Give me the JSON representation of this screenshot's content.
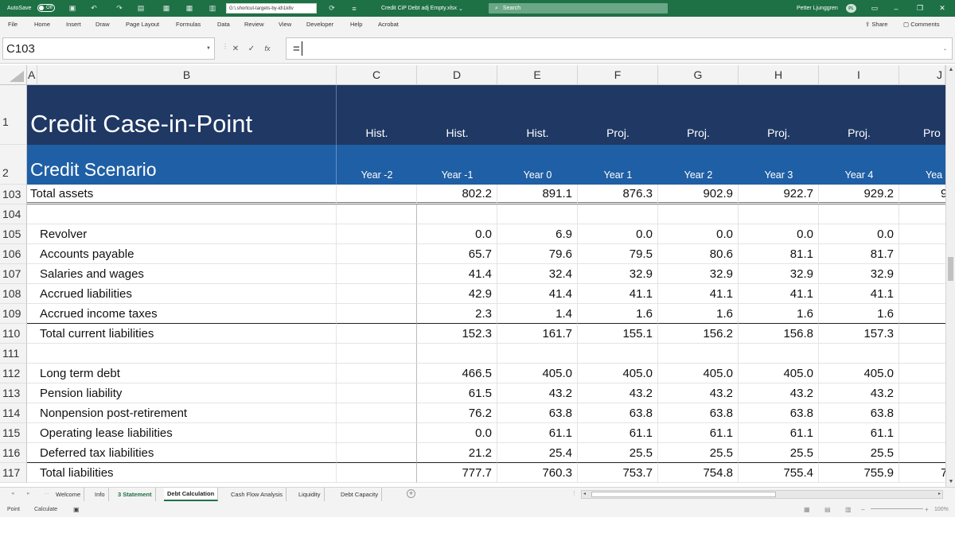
{
  "titlebar": {
    "autosave_label": "AutoSave",
    "autosave_state": "Off",
    "path": "G:\\.shortcut-targets-by-id\\1k8v",
    "filename": "Credit CiP Debt adj Empty.xlsx",
    "search_placeholder": "Search",
    "user": "Petter Ljunggren",
    "user_initials": "PL"
  },
  "ribbon": {
    "tabs": [
      "File",
      "Home",
      "Insert",
      "Draw",
      "Page Layout",
      "Formulas",
      "Data",
      "Review",
      "View",
      "Developer",
      "Help",
      "Acrobat"
    ],
    "share": "Share",
    "comments": "Comments"
  },
  "formula_bar": {
    "name_box": "C103",
    "formula": "="
  },
  "columns": [
    "A",
    "B",
    "C",
    "D",
    "E",
    "F",
    "G",
    "H",
    "I",
    "J"
  ],
  "header": {
    "row1_num": "1",
    "row2_num": "2",
    "title": "Credit Case-in-Point",
    "subtitle": "Credit Scenario",
    "periods": [
      "Hist.",
      "Hist.",
      "Hist.",
      "Proj.",
      "Proj.",
      "Proj.",
      "Proj.",
      "Pro"
    ],
    "years": [
      "Year -2",
      "Year -1",
      "Year 0",
      "Year 1",
      "Year 2",
      "Year 3",
      "Year 4",
      "Yea"
    ]
  },
  "rows": [
    {
      "num": "103",
      "label": "Total assets",
      "values": [
        "",
        "802.2",
        "891.1",
        "876.3",
        "902.9",
        "922.7",
        "929.2",
        "9"
      ],
      "indent": false
    },
    {
      "num": "104",
      "label": "",
      "values": [
        "",
        "",
        "",
        "",
        "",
        "",
        "",
        ""
      ],
      "indent": false
    },
    {
      "num": "105",
      "label": "Revolver",
      "values": [
        "",
        "0.0",
        "6.9",
        "0.0",
        "0.0",
        "0.0",
        "0.0",
        ""
      ],
      "indent": true
    },
    {
      "num": "106",
      "label": "Accounts payable",
      "values": [
        "",
        "65.7",
        "79.6",
        "79.5",
        "80.6",
        "81.1",
        "81.7",
        ""
      ],
      "indent": true
    },
    {
      "num": "107",
      "label": "Salaries and wages",
      "values": [
        "",
        "41.4",
        "32.4",
        "32.9",
        "32.9",
        "32.9",
        "32.9",
        ""
      ],
      "indent": true
    },
    {
      "num": "108",
      "label": "Accrued liabilities",
      "values": [
        "",
        "42.9",
        "41.4",
        "41.1",
        "41.1",
        "41.1",
        "41.1",
        ""
      ],
      "indent": true
    },
    {
      "num": "109",
      "label": "Accrued income taxes",
      "values": [
        "",
        "2.3",
        "1.4",
        "1.6",
        "1.6",
        "1.6",
        "1.6",
        ""
      ],
      "indent": true
    },
    {
      "num": "110",
      "label": "Total current liabilities",
      "values": [
        "",
        "152.3",
        "161.7",
        "155.1",
        "156.2",
        "156.8",
        "157.3",
        ""
      ],
      "indent": true
    },
    {
      "num": "111",
      "label": "",
      "values": [
        "",
        "",
        "",
        "",
        "",
        "",
        "",
        ""
      ],
      "indent": true
    },
    {
      "num": "112",
      "label": "Long term debt",
      "values": [
        "",
        "466.5",
        "405.0",
        "405.0",
        "405.0",
        "405.0",
        "405.0",
        ""
      ],
      "indent": true
    },
    {
      "num": "113",
      "label": "Pension liability",
      "values": [
        "",
        "61.5",
        "43.2",
        "43.2",
        "43.2",
        "43.2",
        "43.2",
        ""
      ],
      "indent": true
    },
    {
      "num": "114",
      "label": "Nonpension post-retirement",
      "values": [
        "",
        "76.2",
        "63.8",
        "63.8",
        "63.8",
        "63.8",
        "63.8",
        ""
      ],
      "indent": true
    },
    {
      "num": "115",
      "label": "Operating lease liabilities",
      "values": [
        "",
        "0.0",
        "61.1",
        "61.1",
        "61.1",
        "61.1",
        "61.1",
        ""
      ],
      "indent": true
    },
    {
      "num": "116",
      "label": "Deferred tax liabilities",
      "values": [
        "",
        "21.2",
        "25.4",
        "25.5",
        "25.5",
        "25.5",
        "25.5",
        ""
      ],
      "indent": true
    },
    {
      "num": "117",
      "label": "Total liabilities",
      "values": [
        "",
        "777.7",
        "760.3",
        "753.7",
        "754.8",
        "755.4",
        "755.9",
        "7"
      ],
      "indent": true
    }
  ],
  "sheets": [
    "Welcome",
    "Info",
    "3 Statement",
    "Debt Calculation",
    "Cash Flow Analysis",
    "Liquidity",
    "Debt Capacity"
  ],
  "active_sheet": "Debt Calculation",
  "status": {
    "mode": "Point",
    "calc": "Calculate",
    "zoom": "100%"
  }
}
